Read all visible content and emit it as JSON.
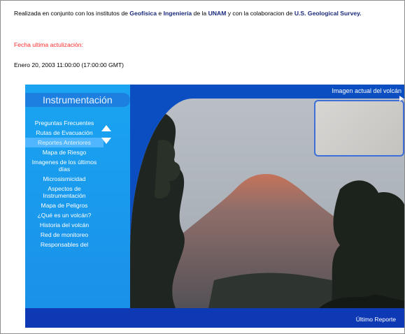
{
  "intro": {
    "part1": "Realizada en conjunto con los institutos de ",
    "geofisica": "Geofísica",
    "conj": " e ",
    "ingenieria": "Ingeniería",
    "part2": " de la ",
    "unam": "UNAM",
    "part3": " y con la colaboracion de ",
    "usgs": "U.S. Geological Survey."
  },
  "fecha_label": "Fecha ultima actulización:",
  "fecha_value": "Enero 20, 2003 11:00:00 (17:00:00 GMT)",
  "banner": {
    "title": "Instrumentación",
    "imagen_label": "Imagen actual del volcán",
    "ultimo_reporte": "Último Reporte",
    "menu": [
      "Preguntas Frecuentes",
      "Rutas de Evacuación",
      "Reportes Anteriores",
      "Mapa de Riesgo",
      "Imagenes de los últimos días",
      "Microsismicidad",
      "Aspectos de Instrumentación",
      "Mapa de Peligros",
      "¿Qué es un volcán?",
      "Historia del volcán",
      "Red de monitoreo",
      "Responsables del"
    ],
    "active_item": "Reportes Anteriores",
    "colors": {
      "banner_blue": "#0a4ec2",
      "sidebar_blue": "#1aa4f2",
      "active_blue": "#4fb6ff"
    },
    "icons": [
      "scroll-up-icon",
      "scroll-down-icon",
      "play-arrow-icon"
    ]
  }
}
